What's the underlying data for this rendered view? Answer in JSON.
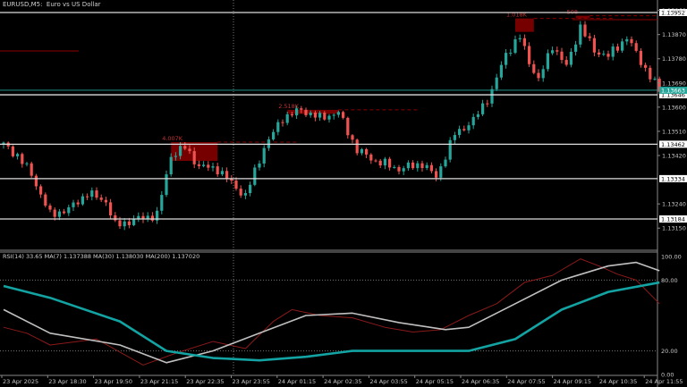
{
  "window": {
    "symbol": "EURUSD,M5",
    "description": "Euro vs US Dollar"
  },
  "colors": {
    "bull": "#26a69a",
    "bear": "#ef5350",
    "zone": "#8b0000",
    "ma200": "#13a3a3",
    "ma30": "#c0c0c0",
    "rsi": "#8b1a1a"
  },
  "price_axis": {
    "scale_ticks": [
      "1.13960",
      "1.13870",
      "1.13780",
      "1.13690",
      "1.13600",
      "1.13510",
      "1.13420",
      "1.13240",
      "1.13150"
    ],
    "scale_values": [
      1.1396,
      1.1387,
      1.1378,
      1.1369,
      1.136,
      1.1351,
      1.1342,
      1.1324,
      1.1315
    ],
    "levels": [
      {
        "label": "1.13952",
        "value": 1.13952
      },
      {
        "label": "1.13646",
        "value": 1.13646
      },
      {
        "label": "1.13462",
        "value": 1.13462
      },
      {
        "label": "1.13334",
        "value": 1.13334
      },
      {
        "label": "1.13184",
        "value": 1.13184
      }
    ],
    "current": {
      "label": "1.13663",
      "value": 1.13663
    }
  },
  "zones": [
    {
      "label": "4.007K",
      "from_bar": 36,
      "to_bar": 46,
      "top": 1.1347,
      "bottom": 1.134
    },
    {
      "label": "2.518K",
      "from_bar": 61,
      "to_bar": 72,
      "top": 1.1359,
      "bottom": 1.13575
    },
    {
      "label": "1.018K",
      "from_bar": 110,
      "to_bar": 114,
      "top": 1.1393,
      "bottom": 1.1388
    },
    {
      "label": "508",
      "from_bar": 123,
      "to_bar": 126,
      "top": 1.1394,
      "bottom": 1.1393
    }
  ],
  "price_path": [
    [
      0,
      1.1346
    ],
    [
      3,
      1.1342
    ],
    [
      6,
      1.1335
    ],
    [
      10,
      1.132
    ],
    [
      14,
      1.1322
    ],
    [
      18,
      1.1328
    ],
    [
      22,
      1.1325
    ],
    [
      24,
      1.1316
    ],
    [
      28,
      1.1318
    ],
    [
      33,
      1.132
    ],
    [
      36,
      1.1342
    ],
    [
      39,
      1.1345
    ],
    [
      42,
      1.1338
    ],
    [
      46,
      1.1337
    ],
    [
      50,
      1.133
    ],
    [
      52,
      1.1327
    ],
    [
      56,
      1.1345
    ],
    [
      60,
      1.1356
    ],
    [
      64,
      1.1359
    ],
    [
      68,
      1.1356
    ],
    [
      72,
      1.1358
    ],
    [
      76,
      1.1344
    ],
    [
      80,
      1.134
    ],
    [
      85,
      1.1337
    ],
    [
      90,
      1.1339
    ],
    [
      93,
      1.1334
    ],
    [
      97,
      1.135
    ],
    [
      101,
      1.1355
    ],
    [
      105,
      1.1366
    ],
    [
      108,
      1.138
    ],
    [
      111,
      1.1386
    ],
    [
      113,
      1.1377
    ],
    [
      115,
      1.137
    ],
    [
      118,
      1.1383
    ],
    [
      121,
      1.1375
    ],
    [
      124,
      1.139
    ],
    [
      127,
      1.1381
    ],
    [
      130,
      1.1379
    ],
    [
      134,
      1.1386
    ],
    [
      137,
      1.1377
    ],
    [
      141,
      1.1366
    ]
  ],
  "rsi_panel": {
    "title": "RSI(14) 33.65 MA(7) 1.137388 MA(30) 1.138030 MA(200) 1.137020",
    "ticks": [
      {
        "label": "100.00",
        "value": 100
      },
      {
        "label": "80.00",
        "value": 80
      },
      {
        "label": "20.00",
        "value": 20
      },
      {
        "label": "0.00",
        "value": 0
      }
    ],
    "ma200": [
      [
        0,
        75
      ],
      [
        10,
        65
      ],
      [
        25,
        45
      ],
      [
        35,
        20
      ],
      [
        45,
        14
      ],
      [
        55,
        12
      ],
      [
        65,
        15
      ],
      [
        75,
        20
      ],
      [
        90,
        20
      ],
      [
        100,
        20
      ],
      [
        110,
        30
      ],
      [
        120,
        55
      ],
      [
        130,
        70
      ],
      [
        141,
        78
      ]
    ],
    "ma30": [
      [
        0,
        55
      ],
      [
        10,
        35
      ],
      [
        25,
        25
      ],
      [
        35,
        10
      ],
      [
        45,
        20
      ],
      [
        55,
        35
      ],
      [
        65,
        50
      ],
      [
        75,
        52
      ],
      [
        85,
        44
      ],
      [
        95,
        38
      ],
      [
        100,
        40
      ],
      [
        110,
        60
      ],
      [
        120,
        80
      ],
      [
        130,
        92
      ],
      [
        136,
        95
      ],
      [
        141,
        88
      ]
    ],
    "rsi": [
      [
        0,
        40
      ],
      [
        5,
        35
      ],
      [
        10,
        25
      ],
      [
        20,
        30
      ],
      [
        30,
        8
      ],
      [
        37,
        18
      ],
      [
        45,
        28
      ],
      [
        52,
        22
      ],
      [
        58,
        45
      ],
      [
        62,
        55
      ],
      [
        68,
        50
      ],
      [
        75,
        48
      ],
      [
        82,
        40
      ],
      [
        88,
        36
      ],
      [
        94,
        38
      ],
      [
        100,
        50
      ],
      [
        106,
        60
      ],
      [
        112,
        78
      ],
      [
        118,
        84
      ],
      [
        124,
        98
      ],
      [
        128,
        92
      ],
      [
        132,
        85
      ],
      [
        136,
        80
      ],
      [
        141,
        60
      ]
    ]
  },
  "time_axis": [
    "23 Apr 2025",
    "23 Apr 18:30",
    "23 Apr 19:50",
    "23 Apr 21:15",
    "23 Apr 22:35",
    "23 Apr 23:55",
    "24 Apr 01:15",
    "24 Apr 02:35",
    "24 Apr 03:55",
    "24 Apr 05:15",
    "24 Apr 06:35",
    "24 Apr 07:55",
    "24 Apr 09:15",
    "24 Apr 10:35",
    "24 Apr 11:55"
  ]
}
